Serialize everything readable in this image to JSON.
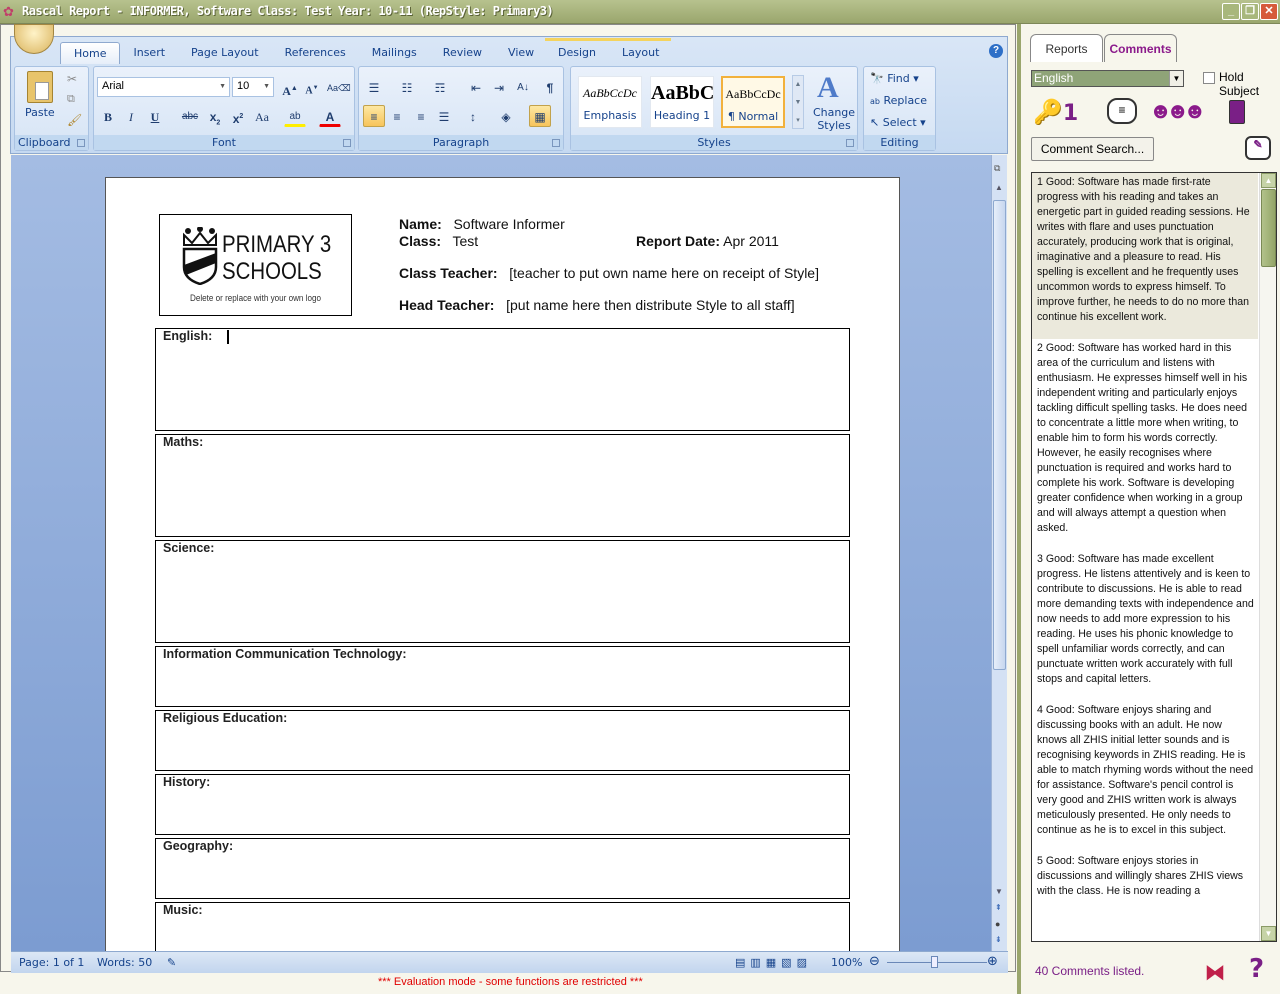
{
  "window": {
    "title": "Rascal Report - INFORMER, Software  Class: Test  Year: 10-11  (RepStyle: Primary3)",
    "controls": [
      "minimize",
      "maximize",
      "close"
    ]
  },
  "ribbon": {
    "tabs": [
      {
        "label": "Home",
        "active": true
      },
      {
        "label": "Insert"
      },
      {
        "label": "Page Layout"
      },
      {
        "label": "References"
      },
      {
        "label": "Mailings"
      },
      {
        "label": "Review"
      },
      {
        "label": "View"
      }
    ],
    "context_tabs": [
      {
        "label": "Design"
      },
      {
        "label": "Layout"
      }
    ],
    "groups": {
      "clipboard": {
        "label": "Clipboard",
        "paste": "Paste"
      },
      "font": {
        "label": "Font",
        "font_name": "Arial",
        "font_size": "10"
      },
      "paragraph": {
        "label": "Paragraph"
      },
      "styles": {
        "label": "Styles",
        "items": [
          {
            "sample": "AaBbCcDc",
            "name": "Emphasis"
          },
          {
            "sample": "AaBbC",
            "name": "Heading 1"
          },
          {
            "sample": "AaBbCcDc",
            "name": "¶ Normal",
            "active": true
          }
        ],
        "change_styles": "Change Styles"
      },
      "editing": {
        "label": "Editing",
        "find": "Find",
        "replace": "Replace",
        "select": "Select"
      }
    }
  },
  "document": {
    "logo": {
      "line1": "PRIMARY 3",
      "line2": "SCHOOLS",
      "caption": "Delete or replace with your own logo"
    },
    "name_label": "Name:",
    "name_value": "Software Informer",
    "class_label": "Class:",
    "class_value": "Test",
    "report_date_label": "Report Date:",
    "report_date_value": "Apr 2011",
    "class_teacher_label": "Class Teacher:",
    "class_teacher_value": "[teacher to put own name here on receipt of Style]",
    "head_teacher_label": "Head Teacher:",
    "head_teacher_value": "[put name here then distribute  Style to all staff]",
    "subjects": [
      {
        "label": "English:"
      },
      {
        "label": "Maths:"
      },
      {
        "label": "Science:"
      },
      {
        "label": "Information Communication  Technology:"
      },
      {
        "label": "Religious Education:"
      },
      {
        "label": "History:"
      },
      {
        "label": "Geography:"
      },
      {
        "label": "Music:"
      }
    ]
  },
  "statusbar": {
    "page": "Page: 1 of 1",
    "words": "Words: 50",
    "zoom": "100%",
    "zoom_percent": 100
  },
  "eval_message": "*** Evaluation mode - some functions are restricted ***",
  "side_panel": {
    "tabs": [
      {
        "label": "Reports"
      },
      {
        "label": "Comments",
        "active": true
      }
    ],
    "subject_select": "English",
    "hold_subject_label": "Hold Subject",
    "hold_subject_checked": false,
    "comment_search": "Comment Search...",
    "comments": [
      "1 Good:  Software has made first-rate progress with his reading and takes an energetic part in guided reading sessions. He writes with flare and uses punctuation accurately, producing work that is original, imaginative and a pleasure to read. His spelling is excellent and he frequently uses uncommon words to express himself. To improve further, he needs to do no more than continue his excellent work.",
      "2 Good:  Software has worked hard in this area of the curriculum and listens with enthusiasm. He expresses himself well in his independent writing and particularly enjoys tackling difficult spelling tasks. He does need to concentrate a little more when writing, to enable him to form his words correctly. However, he easily recognises where punctuation is required and works hard to complete his work. Software is developing greater confidence when working in a group and will always attempt a question when asked.",
      "3 Good:  Software has made excellent progress. He listens attentively and is keen to contribute to discussions. He is able to read more demanding texts with independence and now needs to add more expression to his reading. He uses his phonic knowledge to spell unfamiliar words correctly, and can punctuate written work accurately with full stops and capital letters.",
      "4 Good:  Software enjoys sharing and discussing books with an adult. He now knows all ZHIS initial letter sounds and is recognising keywords in ZHIS reading. He is able to match rhyming words without the need for assistance. Software's pencil control is very good and ZHIS written work is always meticulously presented. He only needs to continue as he is to excel in this subject.",
      "5 Good:  Software enjoys stories in discussions and willingly shares ZHIS views with the class. He is now reading a"
    ],
    "count_text": "40 Comments listed."
  },
  "colors": {
    "titlebar": "#a3ae78",
    "ribbon_text": "#15428b",
    "accent_purple": "#7a1f86",
    "eval_red": "#e00000"
  }
}
